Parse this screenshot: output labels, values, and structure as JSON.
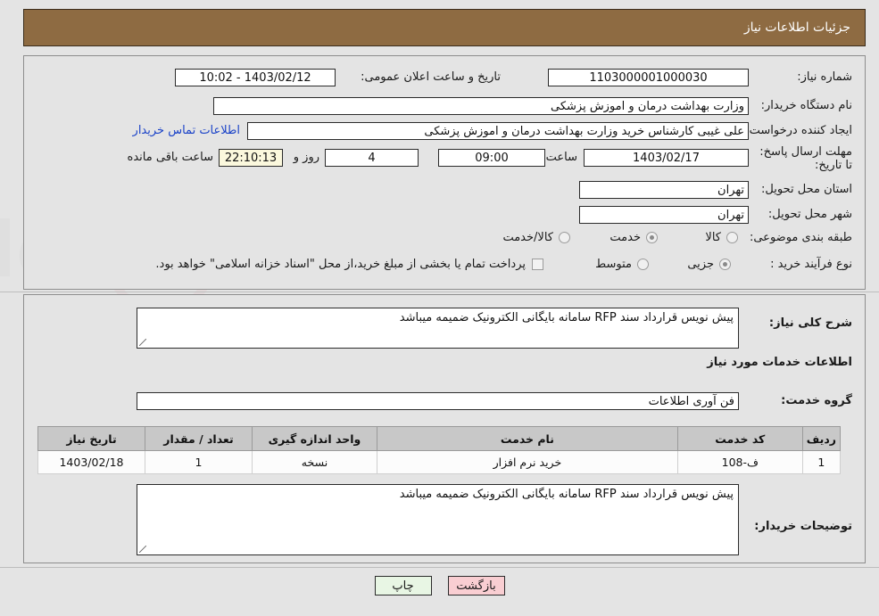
{
  "header": {
    "title": "جزئیات اطلاعات نیاز"
  },
  "form": {
    "need_number_label": "شماره نیاز:",
    "need_number_value": "1103000001000030",
    "announce_label": "تاریخ و ساعت اعلان عمومی:",
    "announce_value": "1403/02/12 - 10:02",
    "buyer_org_label": "نام دستگاه خریدار:",
    "buyer_org_value": "وزارت بهداشت  درمان و اموزش پزشکی",
    "requester_label": "ایجاد کننده درخواست:",
    "requester_value": "علی غیبی کارشناس خرید وزارت بهداشت  درمان و اموزش پزشکی",
    "contact_link": "اطلاعات تماس خریدار",
    "deadline_label": "مهلت ارسال پاسخ: تا تاریخ:",
    "deadline_date": "1403/02/17",
    "deadline_time_label": "ساعت",
    "deadline_time": "09:00",
    "days_remaining": "4",
    "days_label": "روز و",
    "time_remaining": "22:10:13",
    "time_remaining_label": "ساعت باقی مانده",
    "province_label": "استان محل تحویل:",
    "province_value": "تهران",
    "city_label": "شهر محل تحویل:",
    "city_value": "تهران",
    "category_label": "طبقه بندی موضوعی:",
    "category_options": [
      {
        "label": "کالا",
        "selected": false
      },
      {
        "label": "خدمت",
        "selected": true
      },
      {
        "label": "کالا/خدمت",
        "selected": false
      }
    ],
    "process_label": "نوع فرآیند خرید :",
    "process_options": [
      {
        "label": "جزیی",
        "selected": true
      },
      {
        "label": "متوسط",
        "selected": false
      }
    ],
    "treasury_checkbox_label": "پرداخت تمام یا بخشی از مبلغ خرید،از محل \"اسناد خزانه اسلامی\" خواهد بود.",
    "treasury_checked": false
  },
  "detail": {
    "summary_label": "شرح کلی نیاز:",
    "summary_value": "پیش نویس قرارداد سند RFP سامانه بایگانی الکترونیک ضمیمه میباشد",
    "services_section_title": "اطلاعات خدمات مورد نیاز",
    "service_group_label": "گروه خدمت:",
    "service_group_value": "فن آوری اطلاعات",
    "buyer_notes_label": "توضیحات خریدار:",
    "buyer_notes_value": "پیش نویس قرارداد سند RFP سامانه بایگانی الکترونیک ضمیمه میباشد"
  },
  "table": {
    "headers": [
      "ردیف",
      "کد خدمت",
      "نام خدمت",
      "واحد اندازه گیری",
      "تعداد / مقدار",
      "تاریخ نیاز"
    ],
    "rows": [
      [
        "1",
        "ف-108",
        "خرید نرم افزار",
        "نسخه",
        "1",
        "1403/02/18"
      ]
    ]
  },
  "footer": {
    "print_label": "چاپ",
    "back_label": "بازگشت"
  },
  "colors": {
    "header_bg": "#8e6b42",
    "link": "#1b43c8",
    "countdown_bg": "#fbf8dd",
    "print_bg": "#e8f6e4",
    "back_bg": "#f9ced2"
  }
}
